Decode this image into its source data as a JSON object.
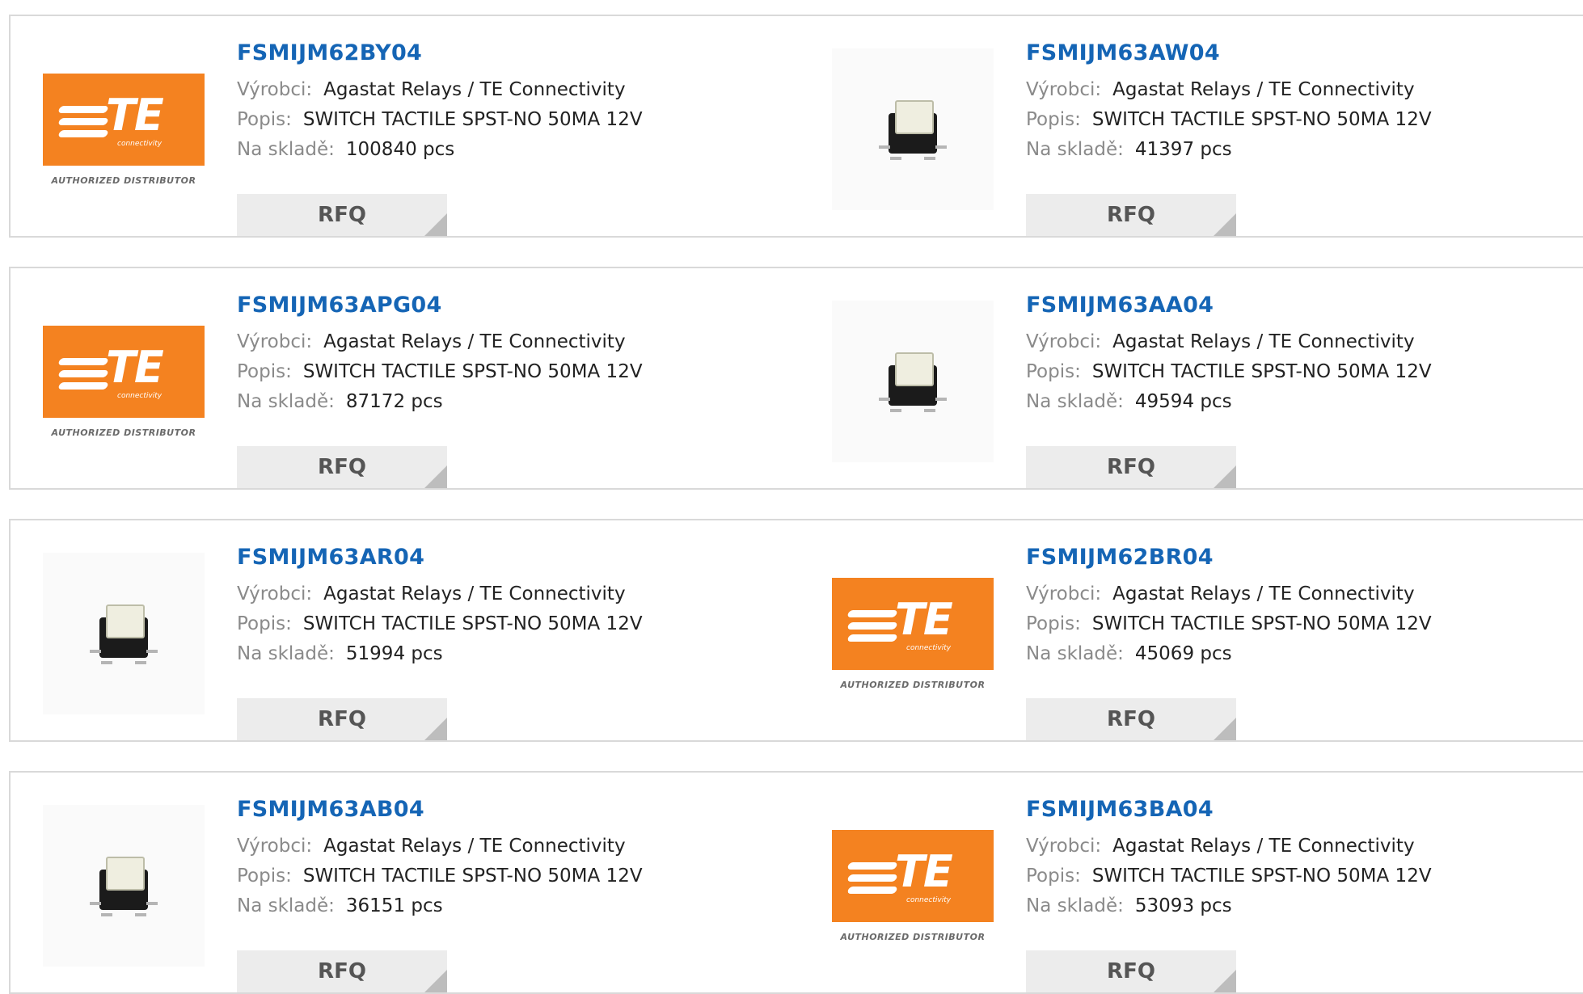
{
  "labels": {
    "manufacturer": "Výrobci:",
    "description": "Popis:",
    "stock": "Na skladě:",
    "rfq": "RFQ"
  },
  "logo": {
    "brand": "TE",
    "tagline": "connectivity",
    "authorized": "AUTHORIZED DISTRIBUTOR"
  },
  "colors": {
    "part_link": "#1565b5",
    "te_orange": "#f48220",
    "rfq_bg": "#ececec"
  },
  "products": [
    {
      "part": "FSMIJM62BY04",
      "manufacturer": "Agastat Relays / TE Connectivity",
      "description": "SWITCH TACTILE SPST-NO 50MA 12V",
      "stock": "100840 pcs",
      "image": "te-logo"
    },
    {
      "part": "FSMIJM63AW04",
      "manufacturer": "Agastat Relays / TE Connectivity",
      "description": "SWITCH TACTILE SPST-NO 50MA 12V",
      "stock": "41397 pcs",
      "image": "switch-photo"
    },
    {
      "part": "FSMIJM63APG04",
      "manufacturer": "Agastat Relays / TE Connectivity",
      "description": "SWITCH TACTILE SPST-NO 50MA 12V",
      "stock": "87172 pcs",
      "image": "te-logo"
    },
    {
      "part": "FSMIJM63AA04",
      "manufacturer": "Agastat Relays / TE Connectivity",
      "description": "SWITCH TACTILE SPST-NO 50MA 12V",
      "stock": "49594 pcs",
      "image": "switch-photo"
    },
    {
      "part": "FSMIJM63AR04",
      "manufacturer": "Agastat Relays / TE Connectivity",
      "description": "SWITCH TACTILE SPST-NO 50MA 12V",
      "stock": "51994 pcs",
      "image": "switch-photo"
    },
    {
      "part": "FSMIJM62BR04",
      "manufacturer": "Agastat Relays / TE Connectivity",
      "description": "SWITCH TACTILE SPST-NO 50MA 12V",
      "stock": "45069 pcs",
      "image": "te-logo"
    },
    {
      "part": "FSMIJM63AB04",
      "manufacturer": "Agastat Relays / TE Connectivity",
      "description": "SWITCH TACTILE SPST-NO 50MA 12V",
      "stock": "36151 pcs",
      "image": "switch-photo"
    },
    {
      "part": "FSMIJM63BA04",
      "manufacturer": "Agastat Relays / TE Connectivity",
      "description": "SWITCH TACTILE SPST-NO 50MA 12V",
      "stock": "53093 pcs",
      "image": "te-logo"
    }
  ]
}
